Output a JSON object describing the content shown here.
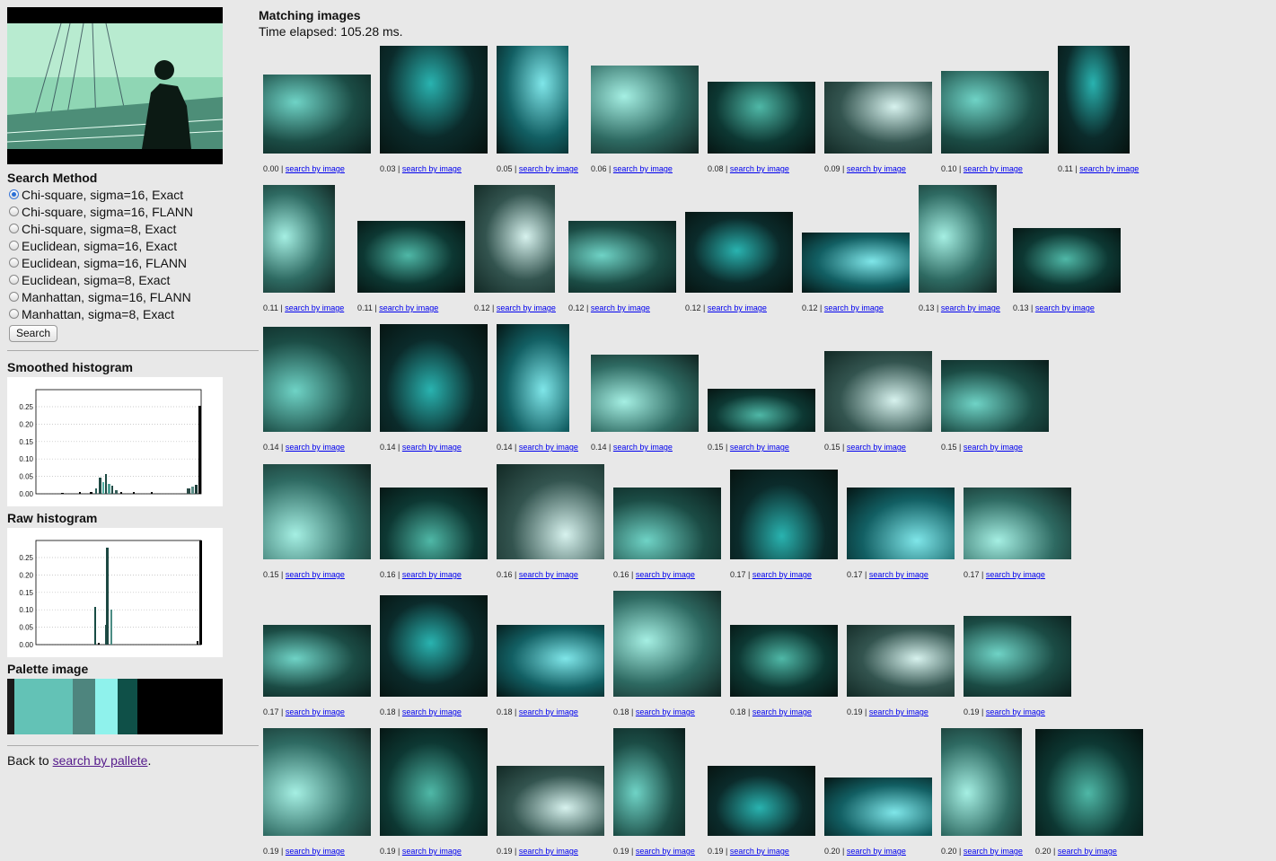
{
  "sidebar": {
    "search_method_title": "Search Method",
    "methods": [
      {
        "label": "Chi-square, sigma=16, Exact",
        "selected": true
      },
      {
        "label": "Chi-square, sigma=16, FLANN",
        "selected": false
      },
      {
        "label": "Chi-square, sigma=8, Exact",
        "selected": false
      },
      {
        "label": "Euclidean, sigma=16, Exact",
        "selected": false
      },
      {
        "label": "Euclidean, sigma=16, FLANN",
        "selected": false
      },
      {
        "label": "Euclidean, sigma=8, Exact",
        "selected": false
      },
      {
        "label": "Manhattan, sigma=16, FLANN",
        "selected": false
      },
      {
        "label": "Manhattan, sigma=8, Exact",
        "selected": false
      }
    ],
    "search_button": "Search",
    "smoothed_title": "Smoothed histogram",
    "raw_title": "Raw histogram",
    "palette_title": "Palette image",
    "back_prefix": "Back to ",
    "back_link": "search by pallete",
    "back_suffix": "."
  },
  "histogram_ticks": [
    "0.25",
    "0.20",
    "0.15",
    "0.10",
    "0.05",
    "0.00"
  ],
  "palette_colors": [
    "#1a1a1a",
    "#63c2b6",
    "#4e857e",
    "#8ff2ec",
    "#0f5048",
    "#000000"
  ],
  "main": {
    "title": "Matching images",
    "elapsed": "Time elapsed: 105.28 ms.",
    "link_label": "search by image"
  },
  "results": [
    [
      "0.00",
      "0.03",
      "0.05",
      "0.06",
      "0.08",
      "0.09",
      "0.10",
      "0.11"
    ],
    [
      "0.11",
      "0.11",
      "0.12",
      "0.12",
      "0.12",
      "0.12",
      "0.13",
      "0.13"
    ],
    [
      "0.14",
      "0.14",
      "0.14",
      "0.14",
      "0.15",
      "0.15",
      "0.15"
    ],
    [
      "0.15",
      "0.16",
      "0.16",
      "0.16",
      "0.17",
      "0.17",
      "0.17"
    ],
    [
      "0.17",
      "0.18",
      "0.18",
      "0.18",
      "0.18",
      "0.19",
      "0.19"
    ],
    [
      "0.19",
      "0.19",
      "0.19",
      "0.19",
      "0.19",
      "0.20",
      "0.20",
      "0.20"
    ]
  ]
}
